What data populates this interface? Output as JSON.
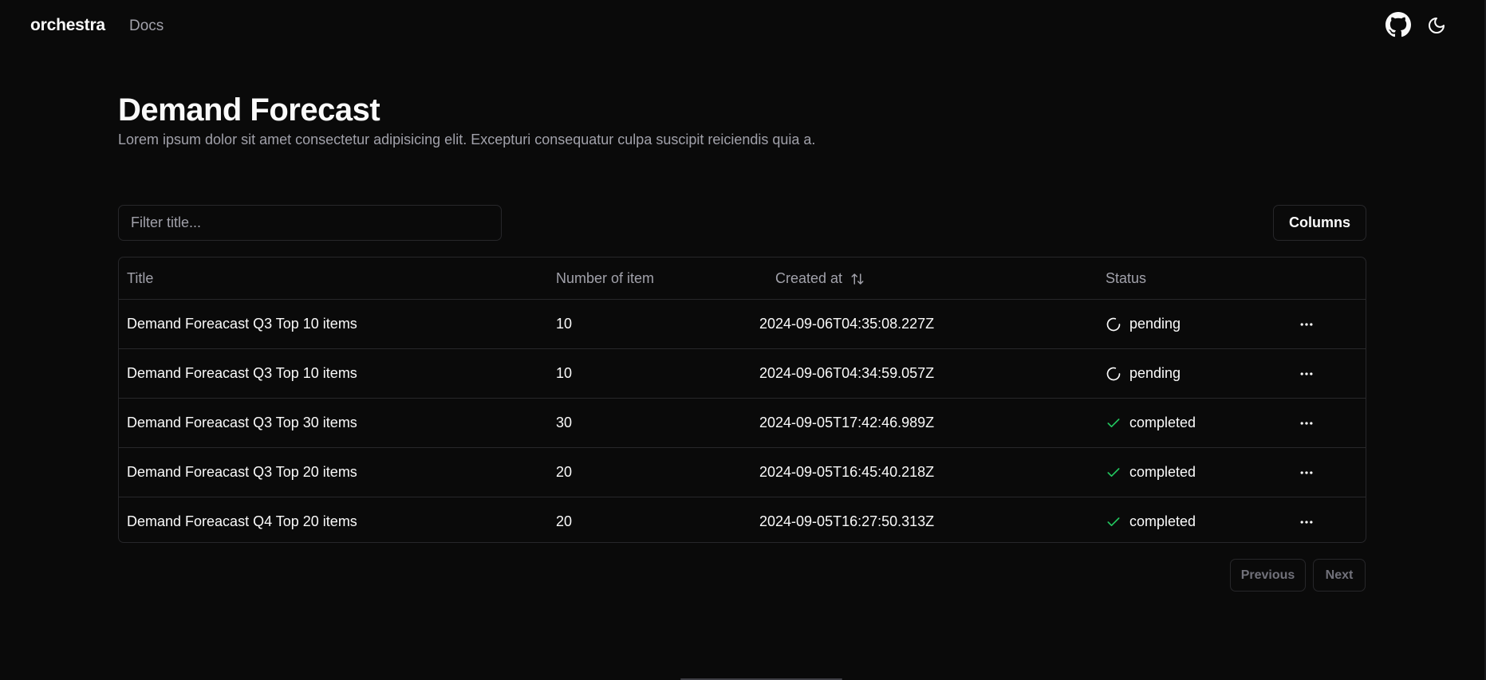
{
  "nav": {
    "brand": "orchestra",
    "docs_label": "Docs",
    "github_icon": "github-icon",
    "theme_icon": "moon-icon"
  },
  "page": {
    "title": "Demand Forecast",
    "subtitle": "Lorem ipsum dolor sit amet consectetur adipisicing elit. Excepturi consequatur culpa suscipit reiciendis quia a."
  },
  "toolbar": {
    "filter_placeholder": "Filter title...",
    "filter_value": "",
    "columns_label": "Columns"
  },
  "table": {
    "headers": {
      "title": "Title",
      "number": "Number of item",
      "created": "Created at",
      "status": "Status"
    },
    "rows": [
      {
        "title": "Demand Foreacast Q3 Top 10 items",
        "number": "10",
        "created": "2024-09-06T04:35:08.227Z",
        "status": "pending"
      },
      {
        "title": "Demand Foreacast Q3 Top 10 items",
        "number": "10",
        "created": "2024-09-06T04:34:59.057Z",
        "status": "pending"
      },
      {
        "title": "Demand Foreacast Q3 Top 30 items",
        "number": "30",
        "created": "2024-09-05T17:42:46.989Z",
        "status": "completed"
      },
      {
        "title": "Demand Foreacast Q3 Top 20 items",
        "number": "20",
        "created": "2024-09-05T16:45:40.218Z",
        "status": "completed"
      },
      {
        "title": "Demand Foreacast Q4 Top 20 items",
        "number": "20",
        "created": "2024-09-05T16:27:50.313Z",
        "status": "completed"
      }
    ]
  },
  "pagination": {
    "previous_label": "Previous",
    "next_label": "Next"
  },
  "colors": {
    "background": "#0a0a0a",
    "border": "#27272a",
    "muted_text": "#a1a1aa",
    "completed_check": "#22c55e"
  }
}
